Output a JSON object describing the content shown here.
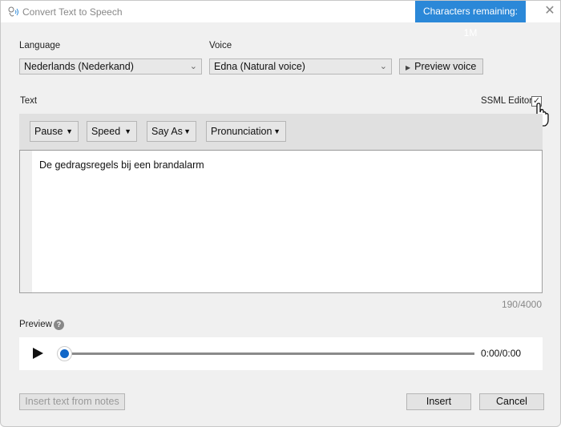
{
  "window": {
    "title": "Convert Text to Speech",
    "characters_remaining": "Characters remaining: 1M",
    "close_glyph": "✕",
    "accent_color": "#2b88d8"
  },
  "language": {
    "label": "Language",
    "selected": "Nederlands (Nederkand)"
  },
  "voice": {
    "label": "Voice",
    "selected": "Edna (Natural voice)",
    "preview_button": "Preview voice"
  },
  "text_section": {
    "label": "Text",
    "ssml_editor_label": "SSML Editor",
    "ssml_editor_checked": true
  },
  "toolbar": {
    "buttons": [
      {
        "label": "Pause"
      },
      {
        "label": "Speed"
      },
      {
        "label": "Say As"
      },
      {
        "label": "Pronunciation"
      }
    ]
  },
  "editor": {
    "content": "De gedragsregels bij een brandalarm",
    "counter": "190/4000"
  },
  "preview": {
    "label": "Preview",
    "help_glyph": "?",
    "progress": 0,
    "time": "0:00/0:00"
  },
  "footer": {
    "insert_from_notes": "Insert text from notes",
    "insert": "Insert",
    "cancel": "Cancel"
  }
}
